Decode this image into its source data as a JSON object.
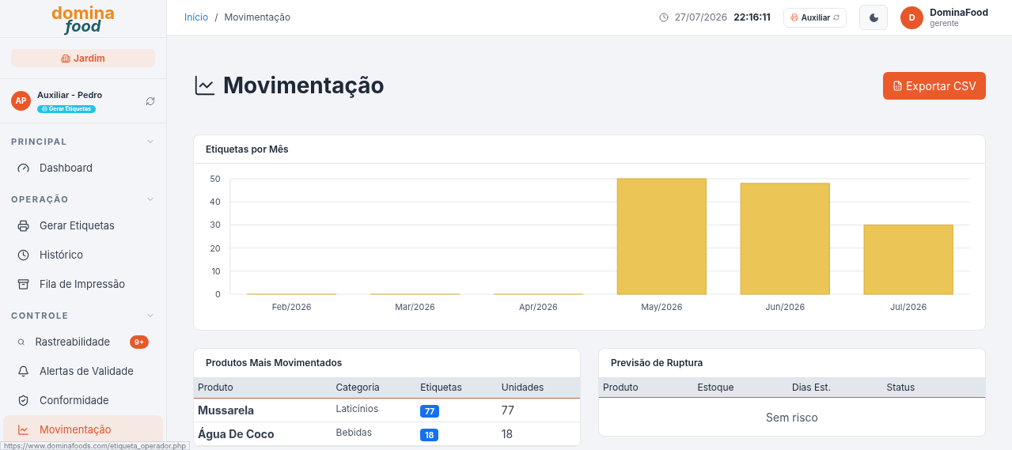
{
  "logo": {
    "line1": "domina",
    "line2": "food"
  },
  "store": {
    "label": "Jardim"
  },
  "user": {
    "initials": "AP",
    "name": "Auxiliar - Pedro",
    "role_badge": "Gerar Etiquetas"
  },
  "sidebar": {
    "sections": [
      {
        "title": "PRINCIPAL",
        "expanded": true,
        "items": [
          {
            "label": "Dashboard",
            "selected": false
          }
        ]
      },
      {
        "title": "OPERAÇÃO",
        "expanded": true,
        "items": [
          {
            "label": "Gerar Etiquetas",
            "selected": false
          },
          {
            "label": "Histórico",
            "selected": false
          },
          {
            "label": "Fila de Impressão",
            "selected": false
          }
        ]
      },
      {
        "title": "CONTROLE",
        "expanded": true,
        "items": [
          {
            "label": "Rastreabilidade",
            "selected": false,
            "badge": "9+"
          },
          {
            "label": "Alertas de Validade",
            "selected": false
          },
          {
            "label": "Conformidade",
            "selected": false
          },
          {
            "label": "Movimentação",
            "selected": true
          }
        ]
      }
    ]
  },
  "breadcrumb": [
    {
      "label": "Início",
      "link": true
    },
    {
      "label": "/",
      "link": false
    },
    {
      "label": "Movimentação",
      "link": false
    }
  ],
  "header": {
    "date": "27/07/2026",
    "time": "22:16:11",
    "mode_button": "Auxiliar",
    "account": {
      "initial": "D",
      "name": "DominaFood",
      "role": "gerente"
    }
  },
  "page": {
    "title": "Movimentação",
    "export_button": "Exportar CSV"
  },
  "chart_card": {
    "title": "Etiquetas por Mês",
    "chart_data": {
      "type": "bar",
      "categories": [
        "Feb/2026",
        "Mar/2026",
        "Apr/2026",
        "May/2026",
        "Jun/2026",
        "Jul/2026"
      ],
      "series": [
        {
          "color": "#ebc555",
          "values": [
            0,
            0,
            0,
            50,
            48,
            30
          ]
        }
      ],
      "grid": true,
      "ylim": [
        0,
        50
      ],
      "yticks": [
        0,
        10,
        20,
        30,
        40,
        50
      ]
    }
  },
  "top_products": {
    "title": "Produtos Mais Movimentados",
    "columns": [
      "Produto",
      "Categoria",
      "Etiquetas",
      "Unidades"
    ],
    "rows": [
      {
        "product": "Mussarela",
        "category": "Laticínios",
        "labels": "77",
        "units": "77"
      },
      {
        "product": "Água De Coco",
        "category": "Bebidas",
        "labels": "18",
        "units": "18"
      }
    ]
  },
  "rupture": {
    "title": "Previsão de Ruptura",
    "columns": [
      "Produto",
      "Estoque",
      "Dias Est.",
      "Status"
    ],
    "empty": "Sem risco"
  },
  "status_bar": {
    "url": "https://www.dominafoods.com/etiqueta_operador.php"
  }
}
